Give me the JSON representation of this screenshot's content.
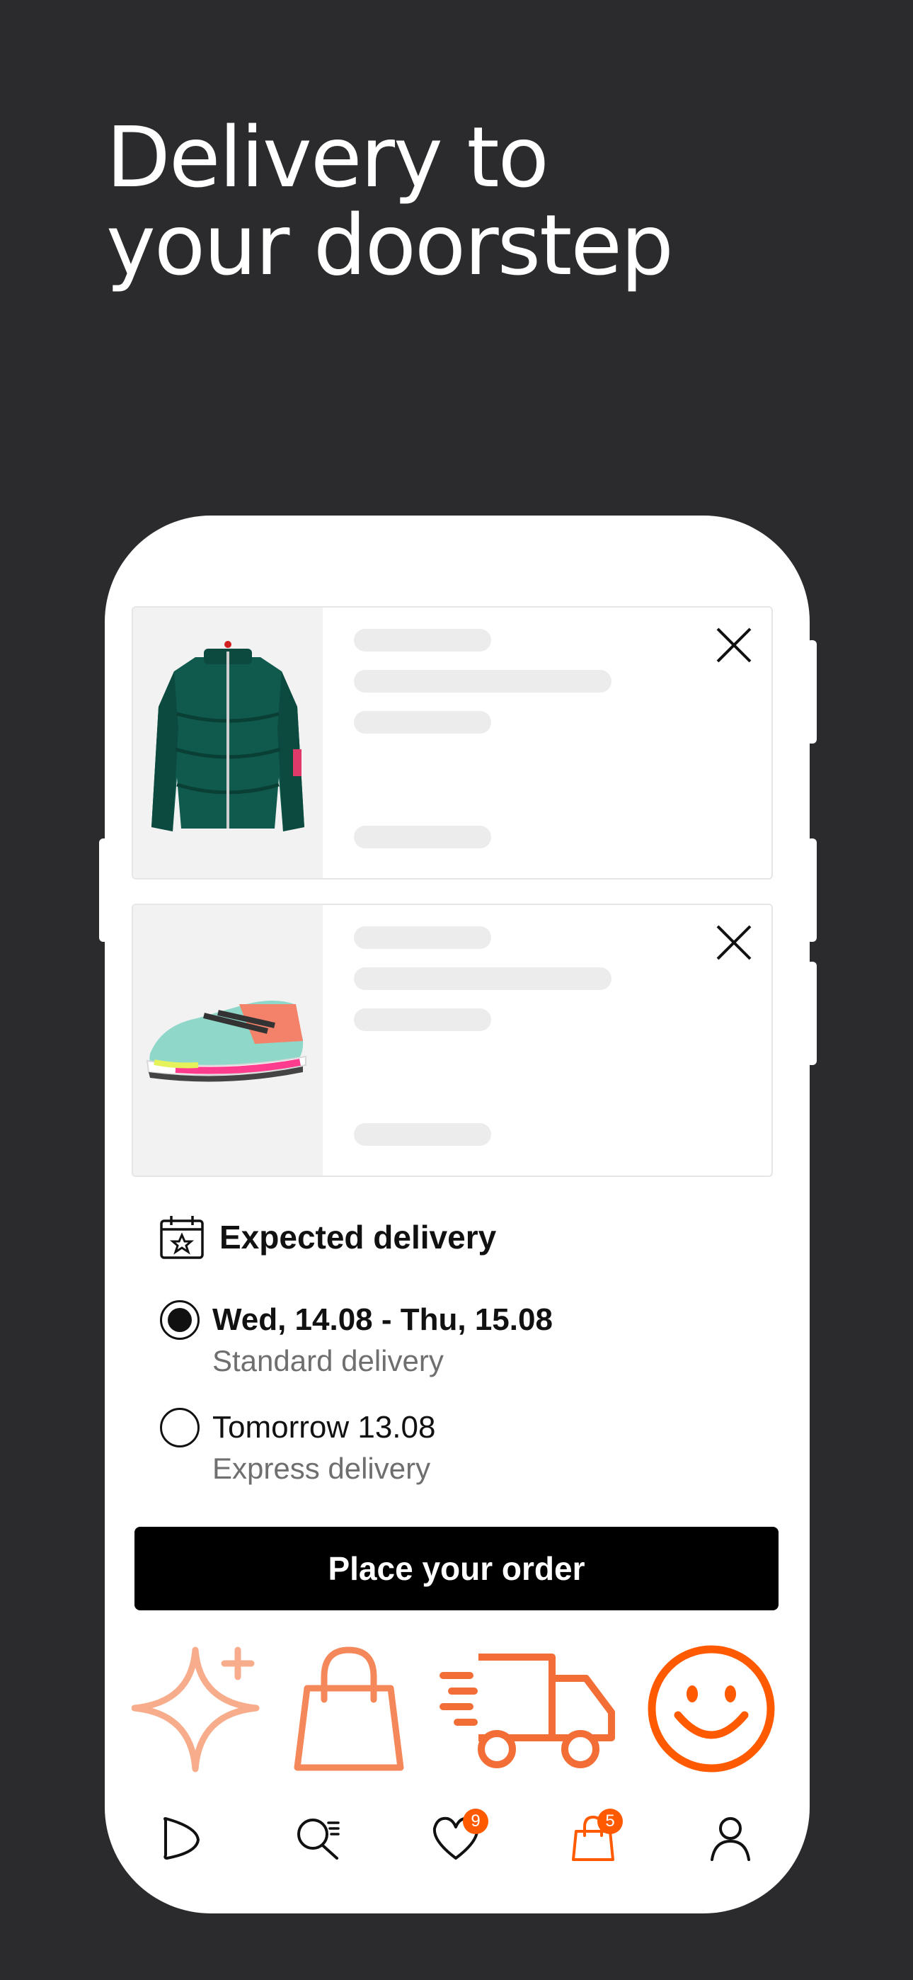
{
  "headline": {
    "line1": "Delivery to",
    "line2": "your doorstep"
  },
  "cart": {
    "items": [
      {
        "product_image": "green-puffer-jacket",
        "remove_icon": "close-icon"
      },
      {
        "product_image": "salomon-sneaker",
        "remove_icon": "close-icon"
      }
    ]
  },
  "delivery": {
    "title": "Expected delivery",
    "icon": "calendar-star-icon",
    "options": [
      {
        "date": "Wed, 14.08 - Thu, 15.08",
        "type": "Standard delivery",
        "selected": true
      },
      {
        "date": "Tomorrow 13.08",
        "type": "Express delivery",
        "selected": false
      }
    ]
  },
  "order_button_label": "Place your order",
  "promo_icons": [
    "sparkle-icon",
    "shopping-bag-icon",
    "delivery-truck-icon",
    "smiley-icon"
  ],
  "tabbar": {
    "items": [
      {
        "name": "home",
        "icon": "play-icon",
        "badge": ""
      },
      {
        "name": "search",
        "icon": "search-icon",
        "badge": ""
      },
      {
        "name": "wishlist",
        "icon": "heart-icon",
        "badge": "9"
      },
      {
        "name": "bag",
        "icon": "bag-icon",
        "badge": "5",
        "active": true
      },
      {
        "name": "profile",
        "icon": "user-icon",
        "badge": ""
      }
    ]
  },
  "colors": {
    "background": "#2b2b2e",
    "accent": "#ff5a00",
    "accent_light": "#f7ad8c",
    "accent_mid": "#f5885a",
    "primary_button": "#000000"
  }
}
